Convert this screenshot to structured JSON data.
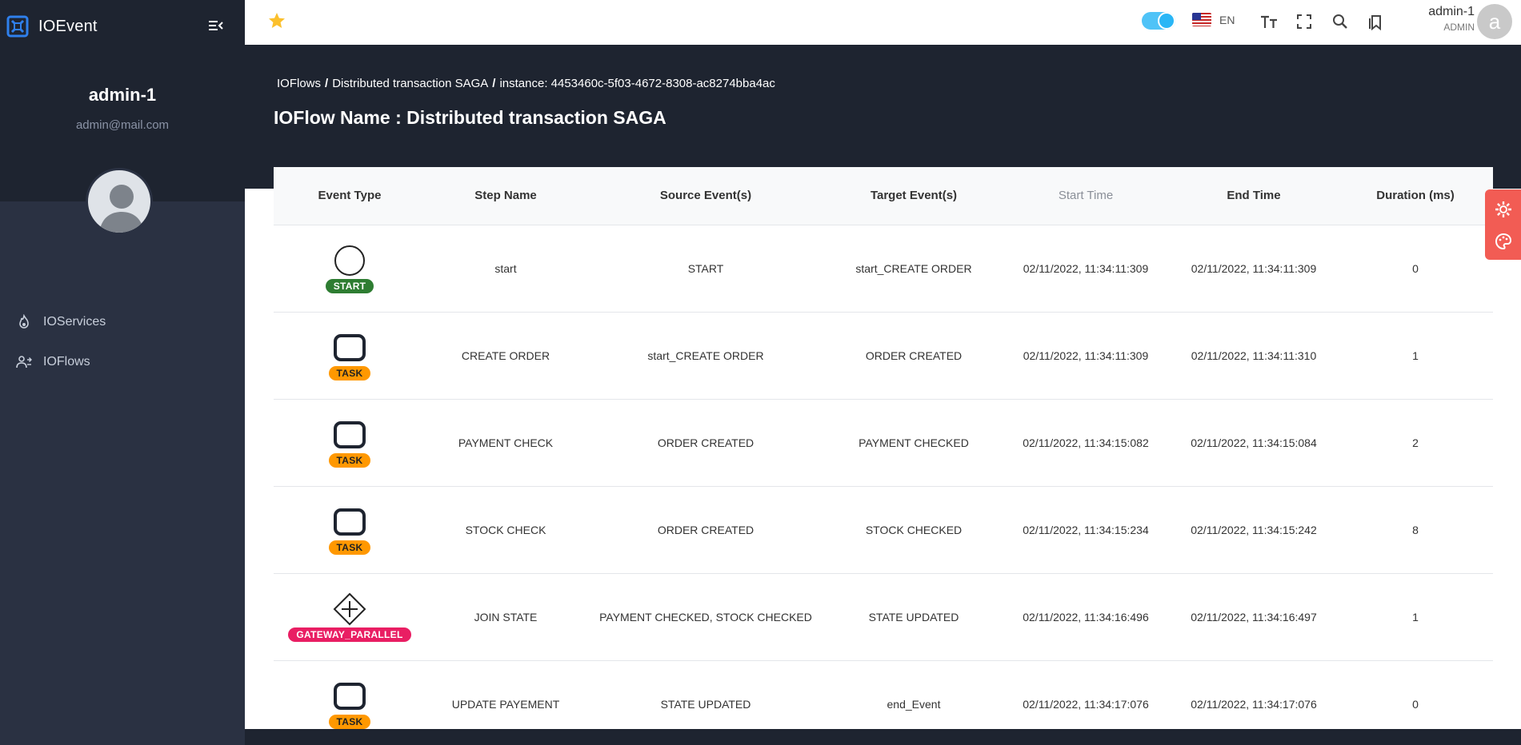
{
  "app": {
    "name": "IOEvent"
  },
  "user": {
    "name": "admin-1",
    "email": "admin@mail.com",
    "role": "ADMIN",
    "initial": "a"
  },
  "sidebar": {
    "items": [
      {
        "label": "IOServices",
        "icon": "fire-icon"
      },
      {
        "label": "IOFlows",
        "icon": "users-flow-icon"
      }
    ]
  },
  "topbar": {
    "language": "EN",
    "toggle_state": "on"
  },
  "breadcrumb": {
    "items": [
      "IOFlows",
      "Distributed transaction SAGA",
      "instance: 4453460c-5f03-4672-8308-ac8274bba4ac"
    ],
    "separator": "/"
  },
  "page": {
    "title": "IOFlow Name : Distributed transaction SAGA"
  },
  "table": {
    "headers": [
      "Event Type",
      "Step Name",
      "Source Event(s)",
      "Target Event(s)",
      "Start Time",
      "End Time",
      "Duration (ms)"
    ],
    "rows": [
      {
        "type": "START",
        "step": "start",
        "source": "START",
        "target": "start_CREATE ORDER",
        "start": "02/11/2022, 11:34:11:309",
        "end": "02/11/2022, 11:34:11:309",
        "duration": "0"
      },
      {
        "type": "TASK",
        "step": "CREATE ORDER",
        "source": "start_CREATE ORDER",
        "target": "ORDER CREATED",
        "start": "02/11/2022, 11:34:11:309",
        "end": "02/11/2022, 11:34:11:310",
        "duration": "1"
      },
      {
        "type": "TASK",
        "step": "PAYMENT CHECK",
        "source": "ORDER CREATED",
        "target": "PAYMENT CHECKED",
        "start": "02/11/2022, 11:34:15:082",
        "end": "02/11/2022, 11:34:15:084",
        "duration": "2"
      },
      {
        "type": "TASK",
        "step": "STOCK CHECK",
        "source": "ORDER CREATED",
        "target": "STOCK CHECKED",
        "start": "02/11/2022, 11:34:15:234",
        "end": "02/11/2022, 11:34:15:242",
        "duration": "8"
      },
      {
        "type": "GATEWAY_PARALLEL",
        "step": "JOIN STATE",
        "source": "PAYMENT CHECKED, STOCK CHECKED",
        "target": "STATE UPDATED",
        "start": "02/11/2022, 11:34:16:496",
        "end": "02/11/2022, 11:34:16:497",
        "duration": "1"
      },
      {
        "type": "TASK",
        "step": "UPDATE PAYEMENT",
        "source": "STATE UPDATED",
        "target": "end_Event",
        "start": "02/11/2022, 11:34:17:076",
        "end": "02/11/2022, 11:34:17:076",
        "duration": "0"
      }
    ]
  },
  "badge_colors": {
    "START": "#2e7d32",
    "TASK": "#ff9800",
    "GATEWAY_PARALLEL": "#e91e63"
  },
  "colors": {
    "sidebar": "#2a3142",
    "header": "#1e2430",
    "accent": "#29b6f6",
    "float_panel": "#f25c54"
  }
}
